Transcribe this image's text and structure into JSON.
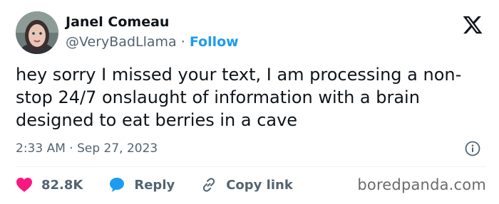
{
  "author": {
    "name": "Janel Comeau",
    "handle": "@VeryBadLlama",
    "separator": "·",
    "follow_label": "Follow"
  },
  "tweet": {
    "text": "hey sorry I missed your text, I am processing a non-stop 24/7 onslaught of information with a brain designed to eat berries in a cave",
    "timestamp": "2:33 AM · Sep 27, 2023"
  },
  "actions": {
    "like_count": "82.8K",
    "reply_label": "Reply",
    "copy_link_label": "Copy link"
  },
  "icons": {
    "platform": "x-logo-icon",
    "info": "info-icon",
    "like": "heart-icon",
    "reply": "speech-bubble-icon",
    "copy": "link-icon"
  },
  "colors": {
    "accent": "#1d9bf0",
    "like": "#f91880",
    "muted": "#536471",
    "text": "#0f1419"
  },
  "watermark": "boredpanda.com"
}
